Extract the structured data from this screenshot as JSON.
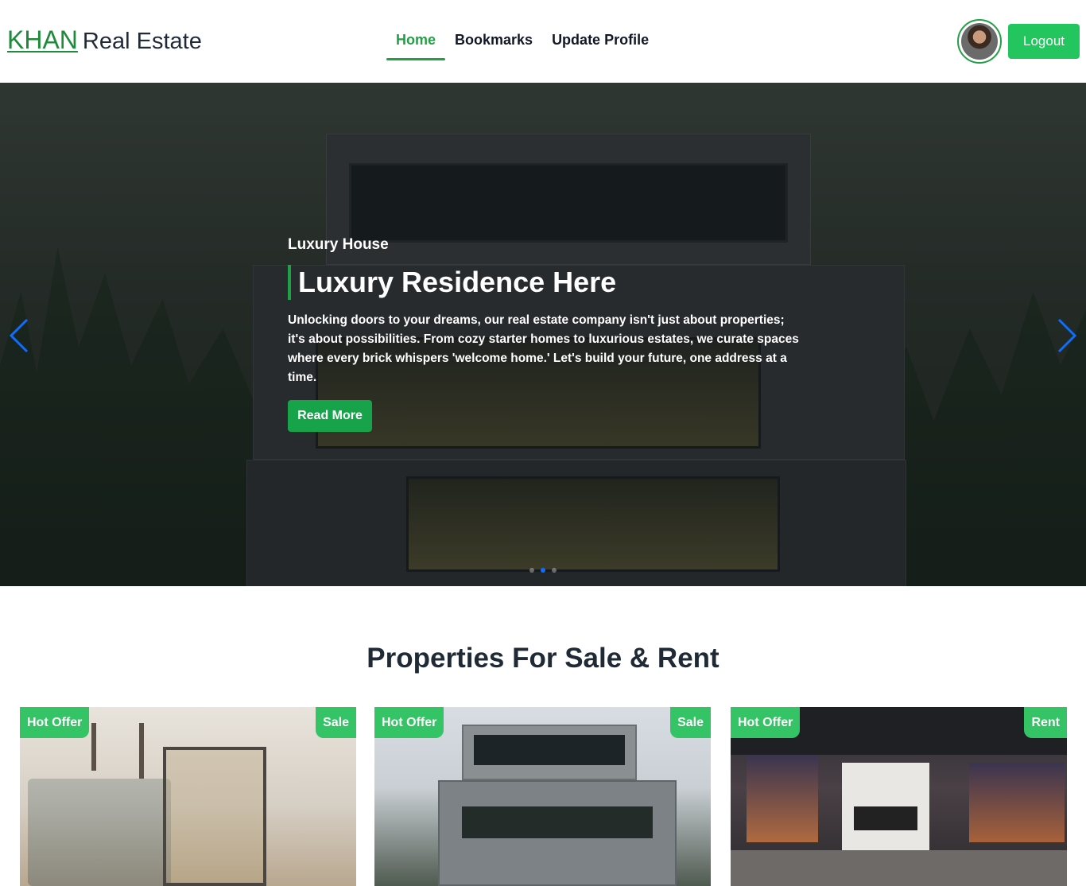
{
  "header": {
    "logo_brand": "KHAN",
    "logo_rest": "Real Estate",
    "nav": [
      {
        "label": "Home",
        "active": true
      },
      {
        "label": "Bookmarks",
        "active": false
      },
      {
        "label": "Update Profile",
        "active": false
      }
    ],
    "logout_label": "Logout"
  },
  "hero": {
    "subtitle": "Luxury House",
    "title": "Luxury Residence Here",
    "text": "Unlocking doors to your dreams, our real estate company isn't just about properties; it's about possibilities. From cozy starter homes to luxurious estates, we curate spaces where every brick whispers 'welcome home.' Let's build your future, one address at a time.",
    "button_label": "Read More",
    "active_slide": 2,
    "slide_count": 3
  },
  "properties": {
    "title": "Properties For Sale & Rent",
    "cards": [
      {
        "left_badge": "Hot Offer",
        "right_badge": "Sale"
      },
      {
        "left_badge": "Hot Offer",
        "right_badge": "Sale"
      },
      {
        "left_badge": "Hot Offer",
        "right_badge": "Rent"
      }
    ]
  },
  "colors": {
    "accent": "#22a046",
    "button_green": "#22c55e",
    "carousel_indicator": "#0d6efd",
    "heading": "#1f2a36"
  }
}
